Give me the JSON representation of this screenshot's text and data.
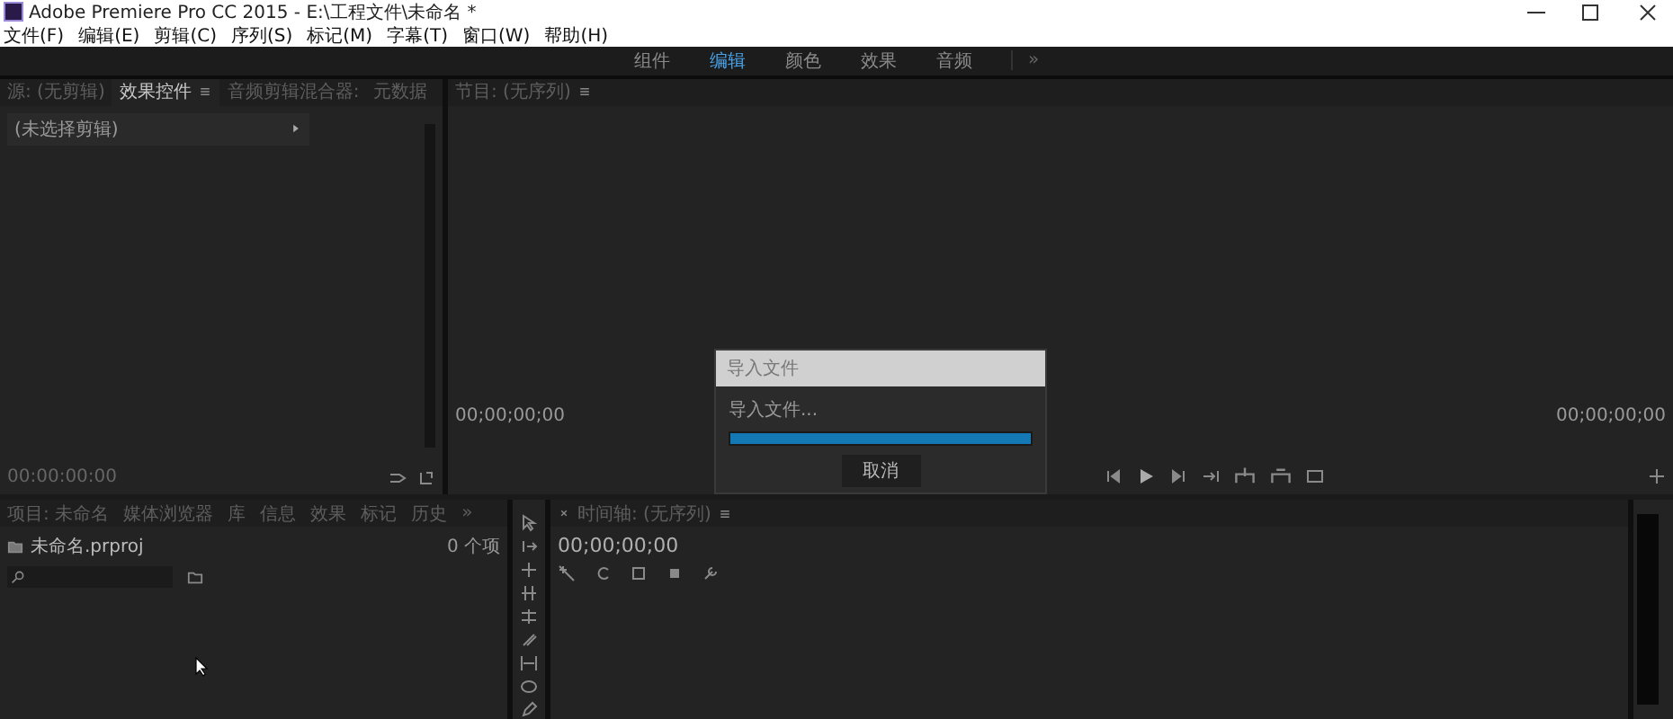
{
  "window": {
    "title": "Adobe Premiere Pro CC 2015 - E:\\工程文件\\未命名 *"
  },
  "menu": [
    "文件(F)",
    "编辑(E)",
    "剪辑(C)",
    "序列(S)",
    "标记(M)",
    "字幕(T)",
    "窗口(W)",
    "帮助(H)"
  ],
  "workspaces": [
    {
      "label": "组件",
      "selected": false
    },
    {
      "label": "编辑",
      "selected": true
    },
    {
      "label": "颜色",
      "selected": false
    },
    {
      "label": "效果",
      "selected": false
    },
    {
      "label": "音频",
      "selected": false
    }
  ],
  "workspace_more": "»",
  "source_panel": {
    "tabs": [
      {
        "label": "源: (无剪辑)",
        "selected": false
      },
      {
        "label": "效果控件",
        "selected": true
      },
      {
        "label": "音频剪辑混合器:",
        "selected": false
      },
      {
        "label": "元数据",
        "selected": false
      }
    ],
    "clip_row": "(未选择剪辑)",
    "timecode": "00:00:00:00"
  },
  "program_monitor": {
    "tab": {
      "label": "节目: (无序列)",
      "selected": false
    },
    "timecode_left": "00;00;00;00",
    "timecode_right": "00;00;00;00"
  },
  "import_dialog": {
    "title": "导入文件",
    "message": "导入文件...",
    "level": 1,
    "button": "取消"
  },
  "project_panel": {
    "tabs": [
      {
        "label": "项目: 未命名",
        "selected": false
      },
      {
        "label": "媒体浏览器",
        "selected": false
      },
      {
        "label": "库",
        "selected": false
      },
      {
        "label": "信息",
        "selected": false
      },
      {
        "label": "效果",
        "selected": false
      },
      {
        "label": "标记",
        "selected": false
      },
      {
        "label": "历史",
        "selected": false
      }
    ],
    "more": "»",
    "project_file": "未命名.prproj",
    "item_count": "0 个项"
  },
  "timeline": {
    "tab": {
      "label": "时间轴: (无序列)",
      "selected": false
    },
    "timecode": "00;00;00;00"
  }
}
